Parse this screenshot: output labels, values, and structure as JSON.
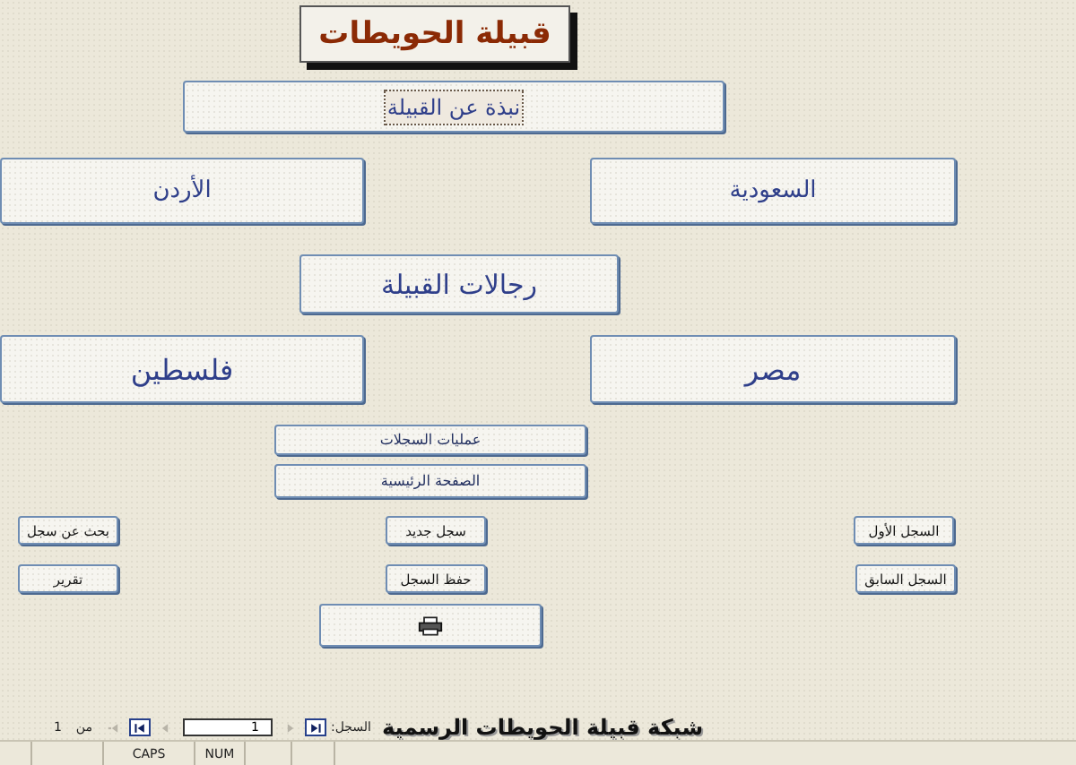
{
  "title": "قبيلة الحويطات",
  "rows": [
    {
      "buttons": [
        {
          "kind": "text",
          "label": "نبذة عن القبيلة",
          "focused": true
        }
      ]
    },
    {
      "buttons": [
        {
          "kind": "text",
          "label": "السعودية",
          "focused": false
        },
        {
          "kind": "text",
          "label": "الأردن",
          "focused": false
        }
      ]
    },
    {
      "buttons": [
        {
          "kind": "text",
          "label": "رجالات القبيلة",
          "focused": false
        }
      ]
    },
    {
      "buttons": [
        {
          "kind": "text",
          "label": "مصر",
          "focused": false
        },
        {
          "kind": "text",
          "label": "فلسطين",
          "focused": false
        }
      ]
    },
    {
      "buttons": [
        {
          "kind": "text",
          "label": "عمليات السجلات",
          "focused": false
        }
      ]
    },
    {
      "buttons": [
        {
          "kind": "text",
          "label": "الصفحة الرئيسية",
          "focused": false
        }
      ]
    },
    {
      "buttons": [
        {
          "kind": "text",
          "label": "السجل الأول",
          "focused": false
        },
        {
          "kind": "text",
          "label": "سجل جديد",
          "focused": false
        },
        {
          "kind": "text",
          "label": "بحث عن سجل",
          "focused": false
        }
      ]
    },
    {
      "buttons": [
        {
          "kind": "text",
          "label": "السجل السابق",
          "focused": false
        },
        {
          "kind": "text",
          "label": "حفظ السجل",
          "focused": false
        },
        {
          "kind": "text",
          "label": "تقرير",
          "focused": false
        }
      ]
    },
    {
      "buttons": [
        {
          "kind": "print",
          "focused": false
        }
      ]
    }
  ],
  "footer_title": "شبكة قبيلة الحويطات الرسمية",
  "navigator": {
    "record_label": "السجل:",
    "buttons_before": [
      {
        "kind": "first",
        "disabled": false
      },
      {
        "kind": "previous",
        "disabled": true
      }
    ],
    "record_value": "1",
    "buttons_after": [
      {
        "kind": "next",
        "disabled": true
      },
      {
        "kind": "last",
        "disabled": false
      },
      {
        "kind": "new",
        "disabled": true
      }
    ],
    "of_label": "من",
    "count": "1"
  },
  "status_bar": {
    "indicators": [
      "NUM",
      "CAPS"
    ]
  }
}
